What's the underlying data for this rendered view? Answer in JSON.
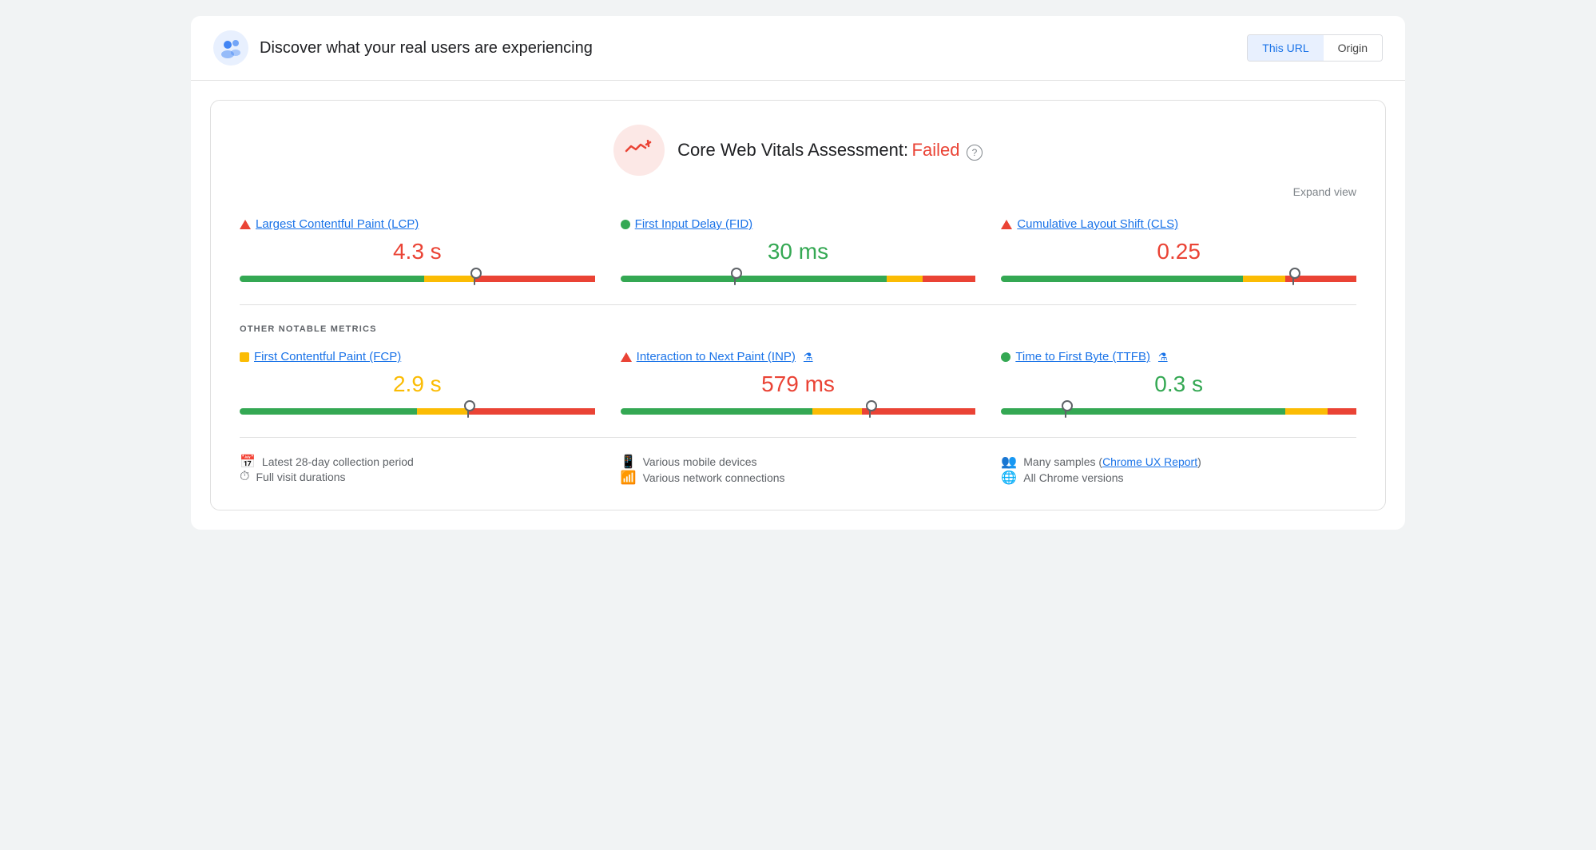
{
  "header": {
    "title": "Discover what your real users are experiencing",
    "logo_icon": "👥",
    "url_toggle": {
      "this_url_label": "This URL",
      "origin_label": "Origin"
    }
  },
  "assessment": {
    "title": "Core Web Vitals Assessment:",
    "status": "Failed",
    "expand_label": "Expand view"
  },
  "core_metrics": [
    {
      "id": "lcp",
      "title": "Largest Contentful Paint (LCP)",
      "indicator": "red-triangle",
      "value": "4.3 s",
      "value_color": "red",
      "gauge": {
        "green_pct": 52,
        "orange_pct": 14,
        "red_pct": 34,
        "marker_pct": 66
      }
    },
    {
      "id": "fid",
      "title": "First Input Delay (FID)",
      "indicator": "green-circle",
      "value": "30 ms",
      "value_color": "green",
      "gauge": {
        "green_pct": 75,
        "orange_pct": 10,
        "red_pct": 15,
        "marker_pct": 32
      }
    },
    {
      "id": "cls",
      "title": "Cumulative Layout Shift (CLS)",
      "indicator": "red-triangle",
      "value": "0.25",
      "value_color": "red",
      "gauge": {
        "green_pct": 68,
        "orange_pct": 12,
        "red_pct": 20,
        "marker_pct": 82
      }
    }
  ],
  "other_metrics_label": "OTHER NOTABLE METRICS",
  "other_metrics": [
    {
      "id": "fcp",
      "title": "First Contentful Paint (FCP)",
      "indicator": "orange-square",
      "has_lab": false,
      "value": "2.9 s",
      "value_color": "orange",
      "gauge": {
        "green_pct": 50,
        "orange_pct": 14,
        "red_pct": 36,
        "marker_pct": 64
      }
    },
    {
      "id": "inp",
      "title": "Interaction to Next Paint (INP)",
      "indicator": "red-triangle",
      "has_lab": true,
      "value": "579 ms",
      "value_color": "red",
      "gauge": {
        "green_pct": 54,
        "orange_pct": 14,
        "red_pct": 32,
        "marker_pct": 70
      }
    },
    {
      "id": "ttfb",
      "title": "Time to First Byte (TTFB)",
      "indicator": "green-circle",
      "has_lab": true,
      "value": "0.3 s",
      "value_color": "green",
      "gauge": {
        "green_pct": 80,
        "orange_pct": 12,
        "red_pct": 8,
        "marker_pct": 18
      }
    }
  ],
  "footer": {
    "col1": [
      {
        "icon": "📅",
        "text": "Latest 28-day collection period"
      },
      {
        "icon": "⏱",
        "text": "Full visit durations"
      }
    ],
    "col2": [
      {
        "icon": "📱",
        "text": "Various mobile devices"
      },
      {
        "icon": "📶",
        "text": "Various network connections"
      }
    ],
    "col3": [
      {
        "icon": "👥",
        "text": "Many samples (",
        "link": "Chrome UX Report",
        "text_after": ")"
      },
      {
        "icon": "🌐",
        "text": "All Chrome versions"
      }
    ]
  }
}
